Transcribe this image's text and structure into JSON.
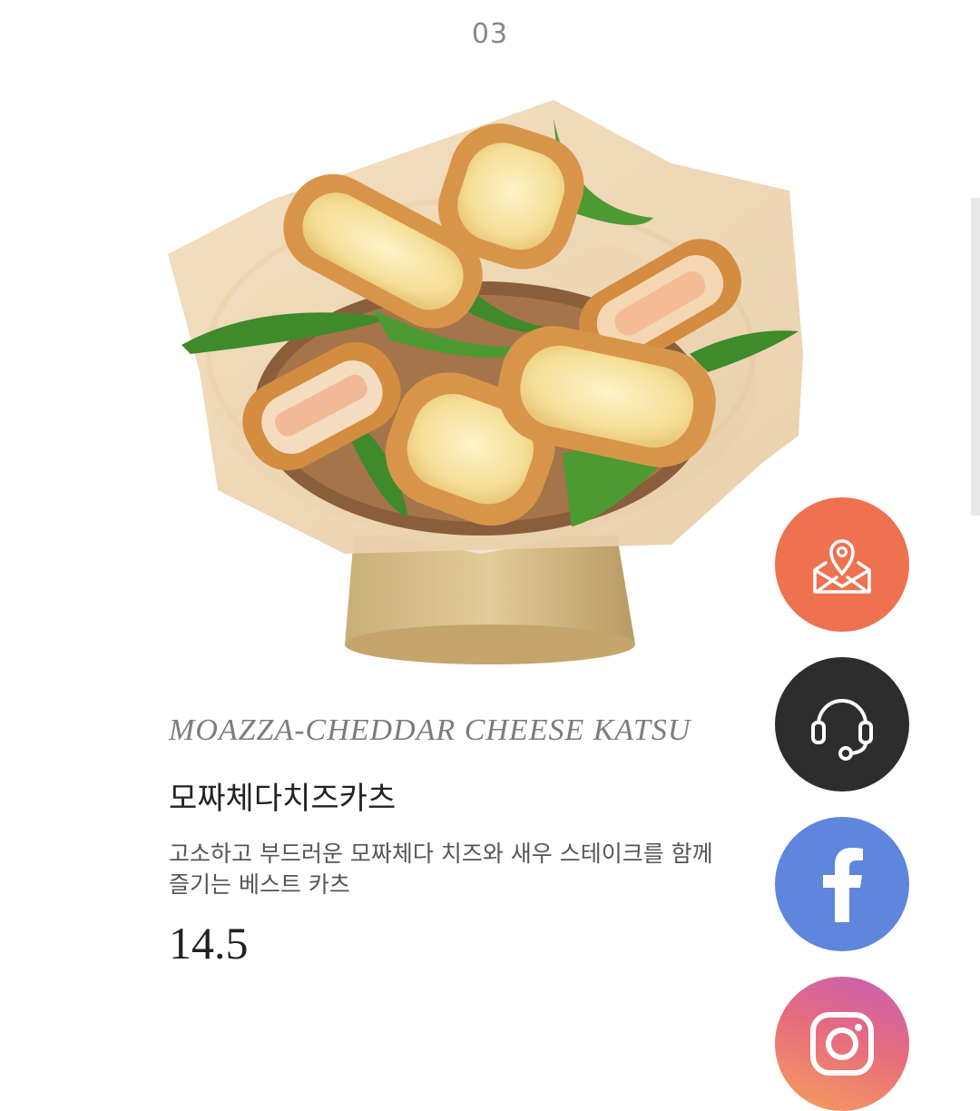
{
  "item": {
    "number": "03",
    "name_en": "MOAZZA-CHEDDAR CHEESE KATSU",
    "name_ko": "모짜체다치즈카츠",
    "description_lines": [
      "고소하고 부드러운 모짜체다 치즈와 새우 스테이크를 함께",
      "즐기는 베스트 카츠"
    ],
    "price": "14.5"
  },
  "floating_buttons": [
    {
      "name": "location-mail-button",
      "icon": "map-pin-envelope-icon",
      "color": "#ee7150"
    },
    {
      "name": "customer-support-button",
      "icon": "headset-icon",
      "color": "#2d2d2d"
    },
    {
      "name": "facebook-button",
      "icon": "facebook-icon",
      "color": "#5f85dd"
    },
    {
      "name": "instagram-button",
      "icon": "instagram-icon",
      "color": "#e66b7f"
    }
  ],
  "colors": {
    "text_primary": "#222222",
    "text_secondary": "#7c7c7c",
    "bowl_gold": "#c7ab74",
    "katsu_crust": "#d8954a",
    "cheese": "#f8e6a6",
    "pepper_green": "#3f8a2a"
  }
}
